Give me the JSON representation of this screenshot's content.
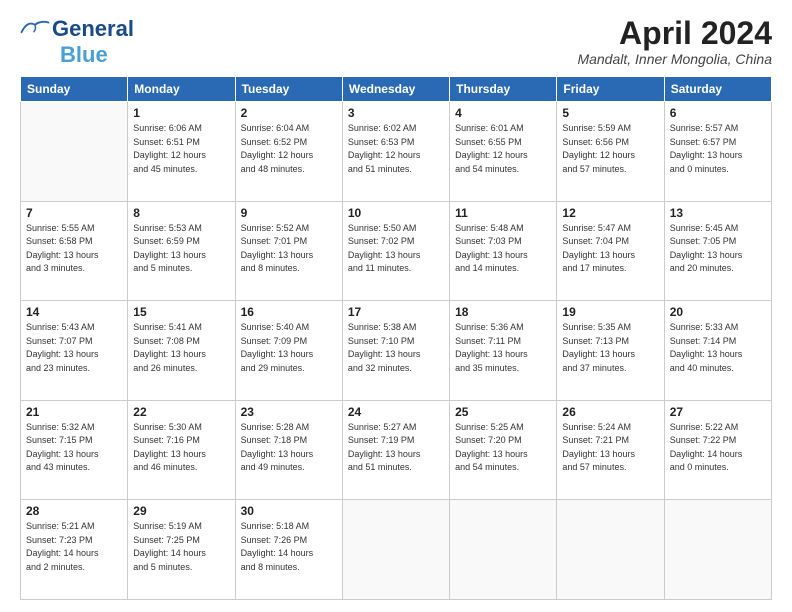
{
  "logo": {
    "text1": "General",
    "text2": "Blue"
  },
  "title": "April 2024",
  "subtitle": "Mandalt, Inner Mongolia, China",
  "header_days": [
    "Sunday",
    "Monday",
    "Tuesday",
    "Wednesday",
    "Thursday",
    "Friday",
    "Saturday"
  ],
  "weeks": [
    [
      {
        "day": "",
        "info": ""
      },
      {
        "day": "1",
        "info": "Sunrise: 6:06 AM\nSunset: 6:51 PM\nDaylight: 12 hours\nand 45 minutes."
      },
      {
        "day": "2",
        "info": "Sunrise: 6:04 AM\nSunset: 6:52 PM\nDaylight: 12 hours\nand 48 minutes."
      },
      {
        "day": "3",
        "info": "Sunrise: 6:02 AM\nSunset: 6:53 PM\nDaylight: 12 hours\nand 51 minutes."
      },
      {
        "day": "4",
        "info": "Sunrise: 6:01 AM\nSunset: 6:55 PM\nDaylight: 12 hours\nand 54 minutes."
      },
      {
        "day": "5",
        "info": "Sunrise: 5:59 AM\nSunset: 6:56 PM\nDaylight: 12 hours\nand 57 minutes."
      },
      {
        "day": "6",
        "info": "Sunrise: 5:57 AM\nSunset: 6:57 PM\nDaylight: 13 hours\nand 0 minutes."
      }
    ],
    [
      {
        "day": "7",
        "info": "Sunrise: 5:55 AM\nSunset: 6:58 PM\nDaylight: 13 hours\nand 3 minutes."
      },
      {
        "day": "8",
        "info": "Sunrise: 5:53 AM\nSunset: 6:59 PM\nDaylight: 13 hours\nand 5 minutes."
      },
      {
        "day": "9",
        "info": "Sunrise: 5:52 AM\nSunset: 7:01 PM\nDaylight: 13 hours\nand 8 minutes."
      },
      {
        "day": "10",
        "info": "Sunrise: 5:50 AM\nSunset: 7:02 PM\nDaylight: 13 hours\nand 11 minutes."
      },
      {
        "day": "11",
        "info": "Sunrise: 5:48 AM\nSunset: 7:03 PM\nDaylight: 13 hours\nand 14 minutes."
      },
      {
        "day": "12",
        "info": "Sunrise: 5:47 AM\nSunset: 7:04 PM\nDaylight: 13 hours\nand 17 minutes."
      },
      {
        "day": "13",
        "info": "Sunrise: 5:45 AM\nSunset: 7:05 PM\nDaylight: 13 hours\nand 20 minutes."
      }
    ],
    [
      {
        "day": "14",
        "info": "Sunrise: 5:43 AM\nSunset: 7:07 PM\nDaylight: 13 hours\nand 23 minutes."
      },
      {
        "day": "15",
        "info": "Sunrise: 5:41 AM\nSunset: 7:08 PM\nDaylight: 13 hours\nand 26 minutes."
      },
      {
        "day": "16",
        "info": "Sunrise: 5:40 AM\nSunset: 7:09 PM\nDaylight: 13 hours\nand 29 minutes."
      },
      {
        "day": "17",
        "info": "Sunrise: 5:38 AM\nSunset: 7:10 PM\nDaylight: 13 hours\nand 32 minutes."
      },
      {
        "day": "18",
        "info": "Sunrise: 5:36 AM\nSunset: 7:11 PM\nDaylight: 13 hours\nand 35 minutes."
      },
      {
        "day": "19",
        "info": "Sunrise: 5:35 AM\nSunset: 7:13 PM\nDaylight: 13 hours\nand 37 minutes."
      },
      {
        "day": "20",
        "info": "Sunrise: 5:33 AM\nSunset: 7:14 PM\nDaylight: 13 hours\nand 40 minutes."
      }
    ],
    [
      {
        "day": "21",
        "info": "Sunrise: 5:32 AM\nSunset: 7:15 PM\nDaylight: 13 hours\nand 43 minutes."
      },
      {
        "day": "22",
        "info": "Sunrise: 5:30 AM\nSunset: 7:16 PM\nDaylight: 13 hours\nand 46 minutes."
      },
      {
        "day": "23",
        "info": "Sunrise: 5:28 AM\nSunset: 7:18 PM\nDaylight: 13 hours\nand 49 minutes."
      },
      {
        "day": "24",
        "info": "Sunrise: 5:27 AM\nSunset: 7:19 PM\nDaylight: 13 hours\nand 51 minutes."
      },
      {
        "day": "25",
        "info": "Sunrise: 5:25 AM\nSunset: 7:20 PM\nDaylight: 13 hours\nand 54 minutes."
      },
      {
        "day": "26",
        "info": "Sunrise: 5:24 AM\nSunset: 7:21 PM\nDaylight: 13 hours\nand 57 minutes."
      },
      {
        "day": "27",
        "info": "Sunrise: 5:22 AM\nSunset: 7:22 PM\nDaylight: 14 hours\nand 0 minutes."
      }
    ],
    [
      {
        "day": "28",
        "info": "Sunrise: 5:21 AM\nSunset: 7:23 PM\nDaylight: 14 hours\nand 2 minutes."
      },
      {
        "day": "29",
        "info": "Sunrise: 5:19 AM\nSunset: 7:25 PM\nDaylight: 14 hours\nand 5 minutes."
      },
      {
        "day": "30",
        "info": "Sunrise: 5:18 AM\nSunset: 7:26 PM\nDaylight: 14 hours\nand 8 minutes."
      },
      {
        "day": "",
        "info": ""
      },
      {
        "day": "",
        "info": ""
      },
      {
        "day": "",
        "info": ""
      },
      {
        "day": "",
        "info": ""
      }
    ]
  ]
}
